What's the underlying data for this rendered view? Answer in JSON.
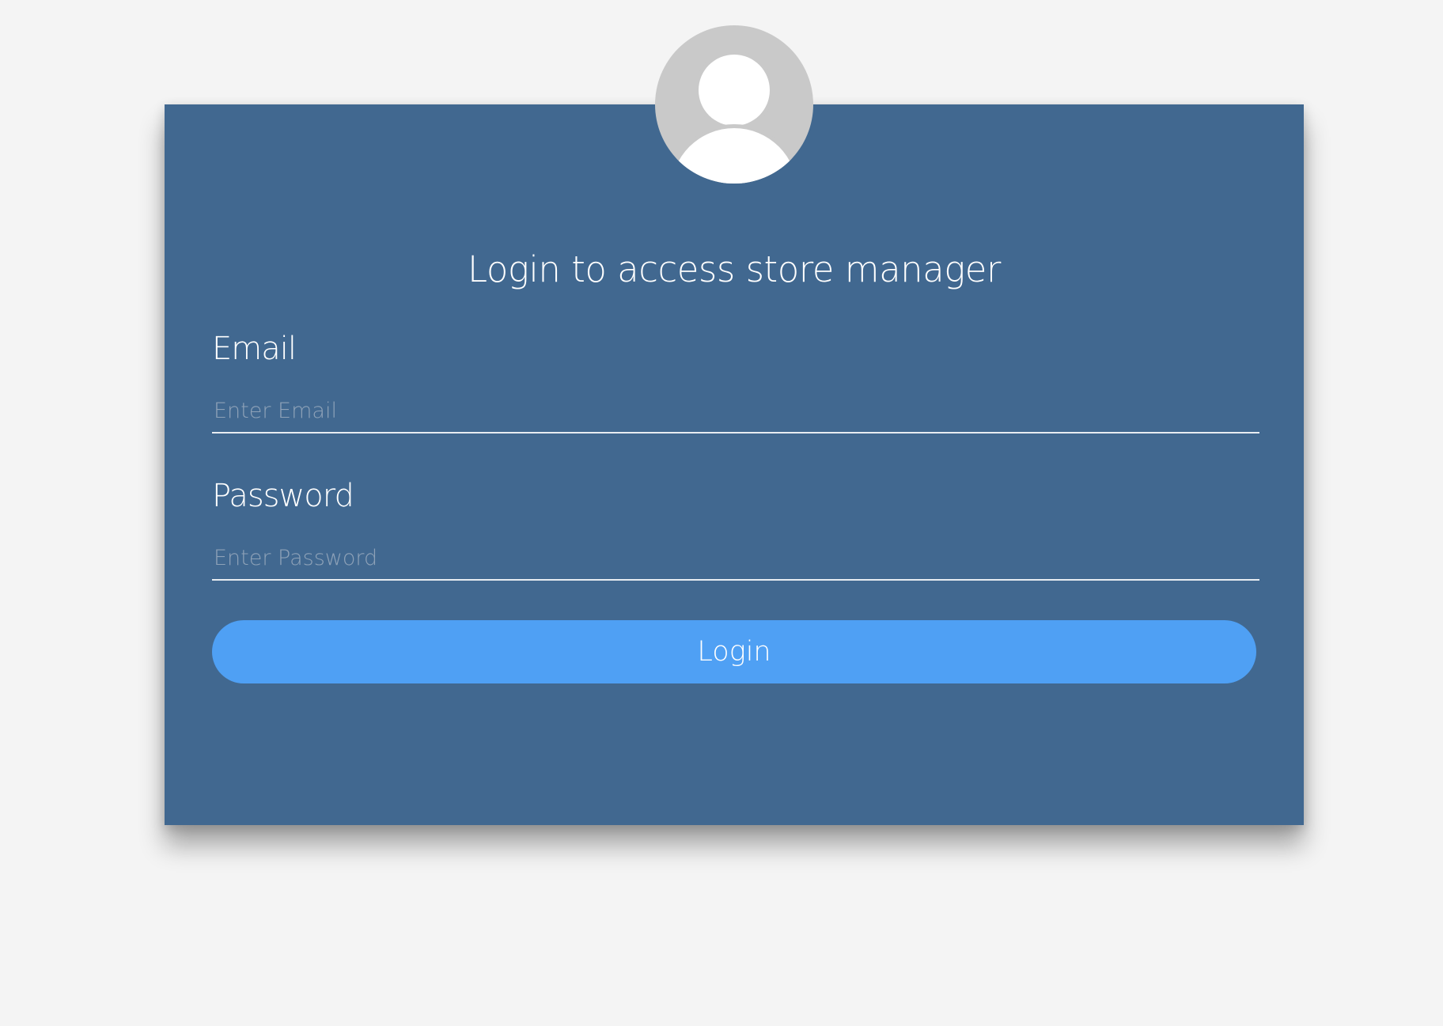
{
  "form": {
    "title": "Login to access store manager",
    "email": {
      "label": "Email",
      "value": "",
      "placeholder": "Enter Email"
    },
    "password": {
      "label": "Password",
      "value": "",
      "placeholder": "Enter Password"
    },
    "login_label": "Login"
  },
  "avatar": {
    "icon": "user-avatar-icon"
  },
  "colors": {
    "page_background": "#f4f4f4",
    "card_background": "#416890",
    "button_background": "#4fa0f4",
    "avatar_background": "#c9c9c9",
    "text": "#ffffff"
  }
}
